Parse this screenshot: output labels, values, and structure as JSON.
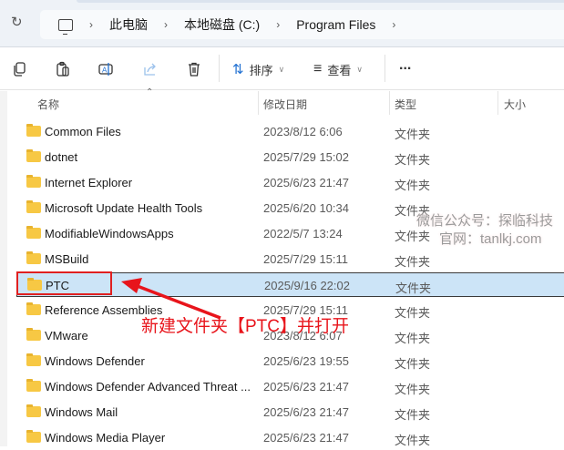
{
  "breadcrumb": [
    "此电脑",
    "本地磁盘 (C:)",
    "Program Files"
  ],
  "toolbar": {
    "sort_label": "排序",
    "view_label": "查看",
    "more_label": "..."
  },
  "columns": {
    "name": "名称",
    "date": "修改日期",
    "type": "类型",
    "size": "大小"
  },
  "rows": [
    {
      "name": "Common Files",
      "date": "2023/8/12 6:06",
      "type": "文件夹"
    },
    {
      "name": "dotnet",
      "date": "2025/7/29 15:02",
      "type": "文件夹"
    },
    {
      "name": "Internet Explorer",
      "date": "2025/6/23 21:47",
      "type": "文件夹"
    },
    {
      "name": "Microsoft Update Health Tools",
      "date": "2025/6/20 10:34",
      "type": "文件夹"
    },
    {
      "name": "ModifiableWindowsApps",
      "date": "2022/5/7 13:24",
      "type": "文件夹"
    },
    {
      "name": "MSBuild",
      "date": "2025/7/29 15:11",
      "type": "文件夹"
    },
    {
      "name": "PTC",
      "date": "2025/9/16 22:02",
      "type": "文件夹",
      "selected": true
    },
    {
      "name": "Reference Assemblies",
      "date": "2025/7/29 15:11",
      "type": "文件夹"
    },
    {
      "name": "VMware",
      "date": "2023/8/12 6:07",
      "type": "文件夹"
    },
    {
      "name": "Windows Defender",
      "date": "2025/6/23 19:55",
      "type": "文件夹"
    },
    {
      "name": "Windows Defender Advanced Threat ...",
      "date": "2025/6/23 21:47",
      "type": "文件夹"
    },
    {
      "name": "Windows Mail",
      "date": "2025/6/23 21:47",
      "type": "文件夹"
    },
    {
      "name": "Windows Media Player",
      "date": "2025/6/23 21:47",
      "type": "文件夹"
    }
  ],
  "annotation": "新建文件夹【PTC】并打开",
  "watermark": {
    "line1": "微信公众号：探临科技",
    "line2": "官网：tanlkj.com"
  }
}
